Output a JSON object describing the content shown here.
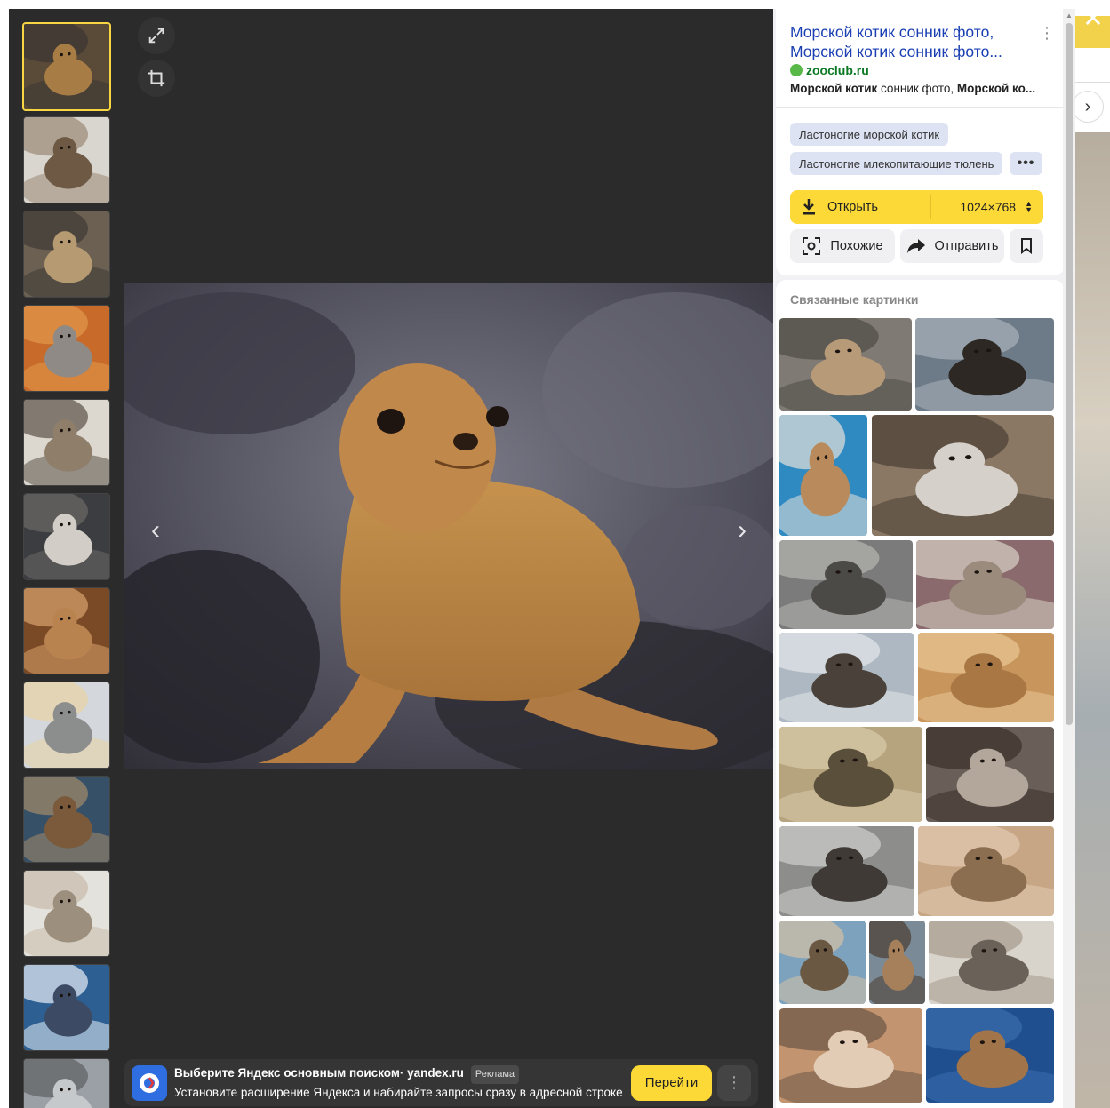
{
  "viewer": {
    "expand_icon": "expand-icon",
    "crop_icon": "crop-icon",
    "prev_icon": "chevron-left-icon",
    "next_icon": "chevron-right-icon",
    "close_icon": "close-icon"
  },
  "thumbnails": [
    {
      "palette": [
        "#5a4a38",
        "#a77d45",
        "#3a3633"
      ],
      "active": true
    },
    {
      "palette": [
        "#d9d5cf",
        "#6e5a44",
        "#9b8975"
      ]
    },
    {
      "palette": [
        "#6b6052",
        "#b59a72",
        "#3e3a34"
      ]
    },
    {
      "palette": [
        "#c76a2a",
        "#8f8a85",
        "#e39a4c"
      ]
    },
    {
      "palette": [
        "#dcd8d0",
        "#8e7e6a",
        "#5b5247"
      ]
    },
    {
      "palette": [
        "#3b3d40",
        "#d2cec7",
        "#6d6a66"
      ]
    },
    {
      "palette": [
        "#7a4a26",
        "#b98350",
        "#d8a36c"
      ]
    },
    {
      "palette": [
        "#d4d7db",
        "#8c8e8e",
        "#e8d3a4"
      ]
    },
    {
      "palette": [
        "#365068",
        "#7a5a3a",
        "#a48a6a"
      ]
    },
    {
      "palette": [
        "#e4e2dc",
        "#9c8f7d",
        "#c7bba9"
      ]
    },
    {
      "palette": [
        "#2e5f93",
        "#3c4b63",
        "#e8eef5"
      ]
    },
    {
      "palette": [
        "#9aa0a6",
        "#c6c9cb",
        "#5d6063"
      ]
    }
  ],
  "panel": {
    "title": "Морской котик сонник фото, Морской котик сонник фото...",
    "menu_icon": "kebab-icon",
    "source": "zooclub.ru",
    "snippet_bold1": "Морской котик",
    "snippet_mid": " сонник фото, ",
    "snippet_bold2": "Морской ко...",
    "tags": [
      "Ластоногие морской котик",
      "Ластоногие млекопитающие тюлень"
    ],
    "more_tags_icon": "more-dots-icon",
    "open_label": "Открыть",
    "size_label": "1024×768",
    "similar_label": "Похожие",
    "share_label": "Отправить",
    "bookmark_icon": "bookmark-icon",
    "related_title": "Связанные картинки"
  },
  "ad": {
    "title": "Выберите Яндекс основным поиском",
    "domain": "· yandex.ru",
    "label": "Реклама",
    "text": "Установите расширение Яндекса и набирайте запросы сразу в адресной строке",
    "button": "Перейти"
  },
  "colors": {
    "accent_yellow": "#fcd937",
    "link_blue": "#1a3fb3",
    "source_green": "#0c7a25",
    "overlay_bg": "#2b2b2b",
    "tag_bg": "#dde3f3"
  },
  "related_images": [
    {
      "palette": [
        "#7f7a74",
        "#b79a78",
        "#4f4b46"
      ]
    },
    {
      "palette": [
        "#6d7b88",
        "#2d2823",
        "#a9b2ba"
      ]
    },
    {
      "palette": [
        "#2f8ac2",
        "#b98a5b",
        "#e6e1d9"
      ]
    },
    {
      "palette": [
        "#8a7865",
        "#d5d0c9",
        "#4a3f35"
      ]
    },
    {
      "palette": [
        "#7b7b7b",
        "#4c4a47",
        "#b7b6b2"
      ]
    },
    {
      "palette": [
        "#8a6a6c",
        "#9a8b7d",
        "#d9d2c7"
      ]
    },
    {
      "palette": [
        "#aeb8c2",
        "#4a423a",
        "#e3e7ea"
      ]
    },
    {
      "palette": [
        "#c8955c",
        "#a87743",
        "#e8c796"
      ]
    },
    {
      "palette": [
        "#b6a47f",
        "#5a4f3a",
        "#d9cba9"
      ]
    },
    {
      "palette": [
        "#6a5f58",
        "#b3a79c",
        "#3a2f2a"
      ]
    },
    {
      "palette": [
        "#8d8d8c",
        "#3f3a36",
        "#cfcfcd"
      ]
    },
    {
      "palette": [
        "#c7a685",
        "#8a6e4f",
        "#e2cbb1"
      ]
    },
    {
      "palette": [
        "#7da2bd",
        "#6b5843",
        "#d4c1a5"
      ]
    },
    {
      "palette": [
        "#7a8a96",
        "#a6805a",
        "#4b3d30"
      ]
    },
    {
      "palette": [
        "#d8d3cb",
        "#6a6159",
        "#a69a8c"
      ]
    },
    {
      "palette": [
        "#c29470",
        "#e2ccb5",
        "#6b5646"
      ]
    },
    {
      "palette": [
        "#1f4f8e",
        "#a2744a",
        "#3b6eae"
      ]
    }
  ]
}
